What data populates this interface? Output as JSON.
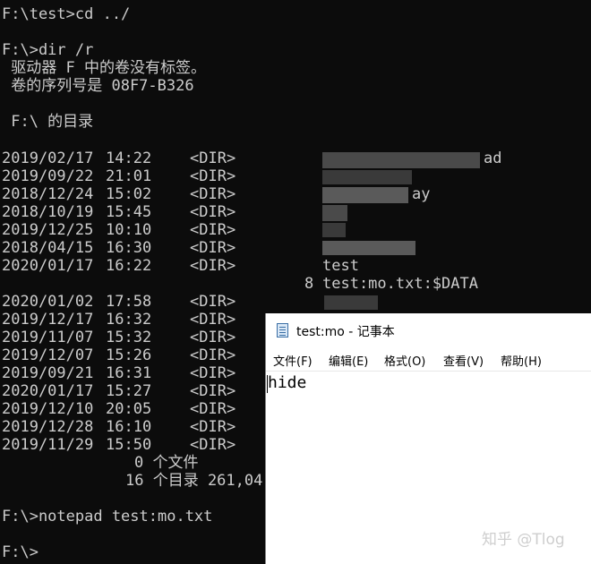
{
  "console": {
    "lines": [
      "F:\\test>cd ../",
      "F:\\>dir /r",
      " 驱动器 F 中的卷没有标签。",
      " 卷的序列号是 08F7-B326",
      " F:\\ 的目录",
      "F:\\>notepad test:mo.txt",
      "F:\\>"
    ],
    "entries_a": [
      {
        "date": "2019/02/17",
        "time": "14:22",
        "type": "<DIR>",
        "name": "ad"
      },
      {
        "date": "2019/09/22",
        "time": "21:01",
        "type": "<DIR>",
        "name": ""
      },
      {
        "date": "2018/12/24",
        "time": "15:02",
        "type": "<DIR>",
        "name": "ay"
      },
      {
        "date": "2018/10/19",
        "time": "15:45",
        "type": "<DIR>",
        "name": ""
      },
      {
        "date": "2019/12/25",
        "time": "10:10",
        "type": "<DIR>",
        "name": ""
      },
      {
        "date": "2018/04/15",
        "time": "16:30",
        "type": "<DIR>",
        "name": ""
      },
      {
        "date": "2020/01/17",
        "time": "16:22",
        "type": "<DIR>",
        "name": "test"
      }
    ],
    "stream": {
      "size": "8",
      "name": "test:mo.txt:$DATA"
    },
    "entries_b": [
      {
        "date": "2020/01/02",
        "time": "17:58",
        "type": "<DIR>"
      },
      {
        "date": "2019/12/17",
        "time": "16:32",
        "type": "<DIR>"
      },
      {
        "date": "2019/11/07",
        "time": "15:32",
        "type": "<DIR>"
      },
      {
        "date": "2019/12/07",
        "time": "15:26",
        "type": "<DIR>"
      },
      {
        "date": "2019/09/21",
        "time": "16:31",
        "type": "<DIR>"
      },
      {
        "date": "2020/01/17",
        "time": "15:27",
        "type": "<DIR>"
      },
      {
        "date": "2019/12/10",
        "time": "20:05",
        "type": "<DIR>"
      },
      {
        "date": "2019/12/28",
        "time": "16:10",
        "type": "<DIR>"
      },
      {
        "date": "2019/11/29",
        "time": "15:50",
        "type": "<DIR>"
      }
    ],
    "summary_files": "0 个文件",
    "summary_dirs": "16 个目录 261,04"
  },
  "notepad": {
    "title": "test:mo - 记事本",
    "menu": [
      "文件(F)",
      "编辑(E)",
      "格式(O)",
      "查看(V)",
      "帮助(H)"
    ],
    "content": "hide"
  },
  "watermark": "知乎 @Tlog",
  "colors": {
    "console_bg": "#0c0c0c",
    "console_fg": "#cccccc",
    "notepad_bg": "#ffffff"
  }
}
